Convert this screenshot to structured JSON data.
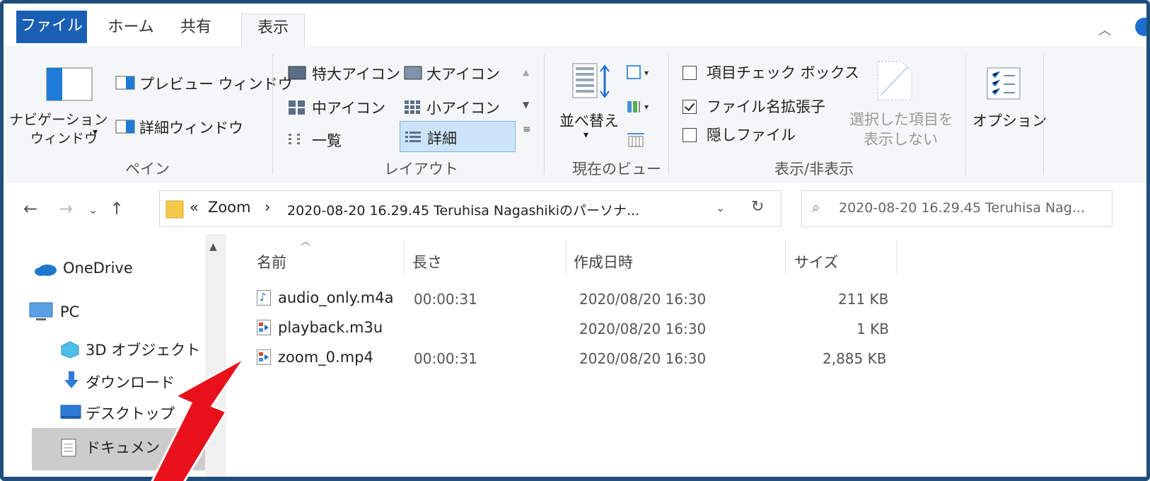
{
  "tabs": {
    "file": "ファイル",
    "home": "ホーム",
    "share": "共有",
    "view": "表示"
  },
  "ribbon": {
    "pane": {
      "nav_pane_line1": "ナビゲーション",
      "nav_pane_line2": "ウィンドウ",
      "preview": "プレビュー ウィンドウ",
      "details": "詳細ウィンドウ",
      "label": "ペイン"
    },
    "layout": {
      "xl_icons": "特大アイコン",
      "large_icons": "大アイコン",
      "medium_icons": "中アイコン",
      "small_icons": "小アイコン",
      "list": "一覧",
      "details": "詳細",
      "label": "レイアウト"
    },
    "current_view": {
      "sort": "並べ替え",
      "label": "現在のビュー"
    },
    "show_hide": {
      "item_checkboxes": "項目チェック ボックス",
      "file_extensions": "ファイル名拡張子",
      "hidden_files": "隠しファイル",
      "hide_selected_line1": "選択した項目を",
      "hide_selected_line2": "表示しない",
      "label": "表示/非表示"
    },
    "options": "オプション"
  },
  "address": {
    "prefix": "«",
    "crumb1": "Zoom",
    "crumb_sep": "›",
    "crumb2": "2020-08-20 16.29.45 Teruhisa Nagashikiのパーソナ...",
    "search_placeholder": "2020-08-20 16.29.45 Teruhisa Nag..."
  },
  "nav": {
    "onedrive": "OneDrive",
    "pc": "PC",
    "objects3d": "3D オブジェクト",
    "downloads": "ダウンロード",
    "desktop": "デスクトップ",
    "documents": "ドキュメン"
  },
  "columns": {
    "name": "名前",
    "length": "長さ",
    "created": "作成日時",
    "size": "サイズ"
  },
  "files": [
    {
      "name": "audio_only.m4a",
      "length": "00:00:31",
      "created": "2020/08/20 16:30",
      "size": "211 KB"
    },
    {
      "name": "playback.m3u",
      "length": "",
      "created": "2020/08/20 16:30",
      "size": "1 KB"
    },
    {
      "name": "zoom_0.mp4",
      "length": "00:00:31",
      "created": "2020/08/20 16:30",
      "size": "2,885 KB"
    }
  ],
  "colors": {
    "accent": "#1a5fb4",
    "annotation_arrow": "#e8101a",
    "frame": "#1f4e79"
  }
}
